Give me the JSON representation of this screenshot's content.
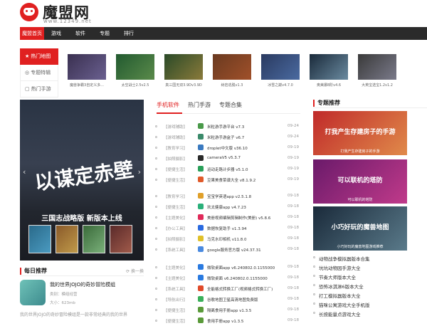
{
  "header": {
    "brand": "魔盟网",
    "domain": "www.12349.net"
  },
  "nav": {
    "items": [
      "魔盟首页",
      "游戏",
      "软件",
      "专题",
      "排行"
    ]
  },
  "side_tabs": [
    "热门地图",
    "专题特辑",
    "热门手游"
  ],
  "side_tab_icons": [
    "★",
    "◎",
    "▢"
  ],
  "thumbs": [
    {
      "label": "魔兽争霸3自定义多...",
      "color1": "#3a3050",
      "color2": "#6a6090"
    },
    {
      "label": "太空战士2.5v2.5",
      "color1": "#225a30",
      "color2": "#5a8a4a"
    },
    {
      "label": "真三国无双3.9Dv3.9D",
      "color1": "#2a4a28",
      "color2": "#8a7a3a"
    },
    {
      "label": "树岩逃脱v1.3",
      "color1": "#6a3a20",
      "color2": "#a0502a"
    },
    {
      "label": "冰雪之巅v4.7.0",
      "color1": "#2a3a60",
      "color2": "#4a6aa0"
    },
    {
      "label": "奥美娜8阶v4.6",
      "color1": "#1a2a3a",
      "color2": "#6a8aa0"
    },
    {
      "label": "大英宝选宝1.2v1.2",
      "color1": "#3a3a3a",
      "color2": "#7a7a8a"
    }
  ],
  "banner": {
    "title": "以谋定赤壁",
    "subtitle": "三国志战略版 新版本上线",
    "prev": "‹",
    "next": "›"
  },
  "daily": {
    "title": "每日推荐",
    "more": "⟳ 换一换",
    "game_title": "我的世界JOJO的奇妙冒险模组",
    "category": "类别：模组经营",
    "size": "大小：623mb",
    "desc": "我的世界JOJO的奇妙冒险模组是一款非常经典的我的世界"
  },
  "main_tabs": [
    "手机软件",
    "热门手游",
    "专题合集"
  ],
  "list": [
    {
      "cat": "【游戏辅助】",
      "name": "米粒游手游平台 v7.3",
      "date": "09-24",
      "color": "#4a9a4a"
    },
    {
      "cat": "【游戏辅助】",
      "name": "米粒游手游盒子 v6.7",
      "date": "09-24",
      "color": "#3a8a6a"
    },
    {
      "cat": "【教育学习】",
      "name": "droplet中文版 v36.10",
      "date": "09-19",
      "color": "#3a7ac0"
    },
    {
      "cat": "【拍照摄影】",
      "name": "cameraV5 v5.3.7",
      "date": "09-19",
      "color": "#2a2a2a"
    },
    {
      "cat": "【便捷生活】",
      "name": "运动走路计步器 v5.1.0",
      "date": "09-19",
      "color": "#2aa05a"
    },
    {
      "cat": "【便捷生活】",
      "name": "豆果美食菜谱大全 v8.1.9.2",
      "date": "09-19",
      "color": "#e05a2a"
    },
    {
      "cat": "【教育学习】",
      "name": "宝宝学英语app v2.5.1.8",
      "date": "09-18",
      "color": "#e0a02a"
    },
    {
      "cat": "【便捷生活】",
      "name": "欢太健康app v4.7.23",
      "date": "09-18",
      "color": "#2ab07a"
    },
    {
      "cat": "【主题美化】",
      "name": "美册视频编辑剪辑制作(美册) v5.8.6",
      "date": "09-18",
      "color": "#e02a5a"
    },
    {
      "cat": "【办公工具】",
      "name": "数据恢复助手 v1.3.94",
      "date": "09-18",
      "color": "#2a6ae0"
    },
    {
      "cat": "【拍照摄影】",
      "name": "马克水印相机 v11.8.0",
      "date": "09-18",
      "color": "#e0c02a"
    },
    {
      "cat": "【系统工具】",
      "name": "google服务官方版 v24.37.31",
      "date": "09-18",
      "color": "#4a8ae0"
    },
    {
      "cat": "【主题美化】",
      "name": "微软桌面app v6.240802.0.1155000",
      "date": "09-18",
      "color": "#2a7ae0"
    },
    {
      "cat": "【主题美化】",
      "name": "微软桌面 v6.240802.0.1155000",
      "date": "09-18",
      "color": "#2a7ae0"
    },
    {
      "cat": "【系统工具】",
      "name": "全能格式转换工厂(视频格式转换工厂)",
      "date": "09-18",
      "color": "#e04a2a"
    },
    {
      "cat": "【导航出行】",
      "name": "谷歌地图卫星高清地图免费版",
      "date": "09-18",
      "color": "#3ab05a"
    },
    {
      "cat": "【便捷生活】",
      "name": "隔离食用手册app v1.3.5",
      "date": "09-18",
      "color": "#5a9a3a"
    },
    {
      "cat": "【便捷生活】",
      "name": "食用手册app v1.3.5",
      "date": "09-18",
      "color": "#5a9a3a"
    }
  ],
  "special": {
    "title": "专题推荐",
    "banners": [
      {
        "t1": "打我产生存建房子的手游",
        "t2": "打我产生存建房子的手游",
        "c1": "#c02a2a",
        "c2": "#e08a4a"
      },
      {
        "t1": "可以联机的塔防",
        "t2": "可以联机的塔防",
        "c1": "#6a1a6a",
        "c2": "#c03a8a"
      },
      {
        "t1": "小巧好玩的魔兽地图",
        "t2": "小巧好玩的魔兽地图游戏推荐",
        "c1": "#1a2a3a",
        "c2": "#5a7a8a"
      }
    ],
    "list": [
      "动物战争模拟器版本合集",
      "坑坑动物园手游大全",
      "节奏大师版本大全",
      "恐怖冰淇淋6版本大全",
      "打工模拟器版本大全",
      "猫咪公寓游戏大全手机版",
      "长按能量点游戏大全"
    ]
  }
}
